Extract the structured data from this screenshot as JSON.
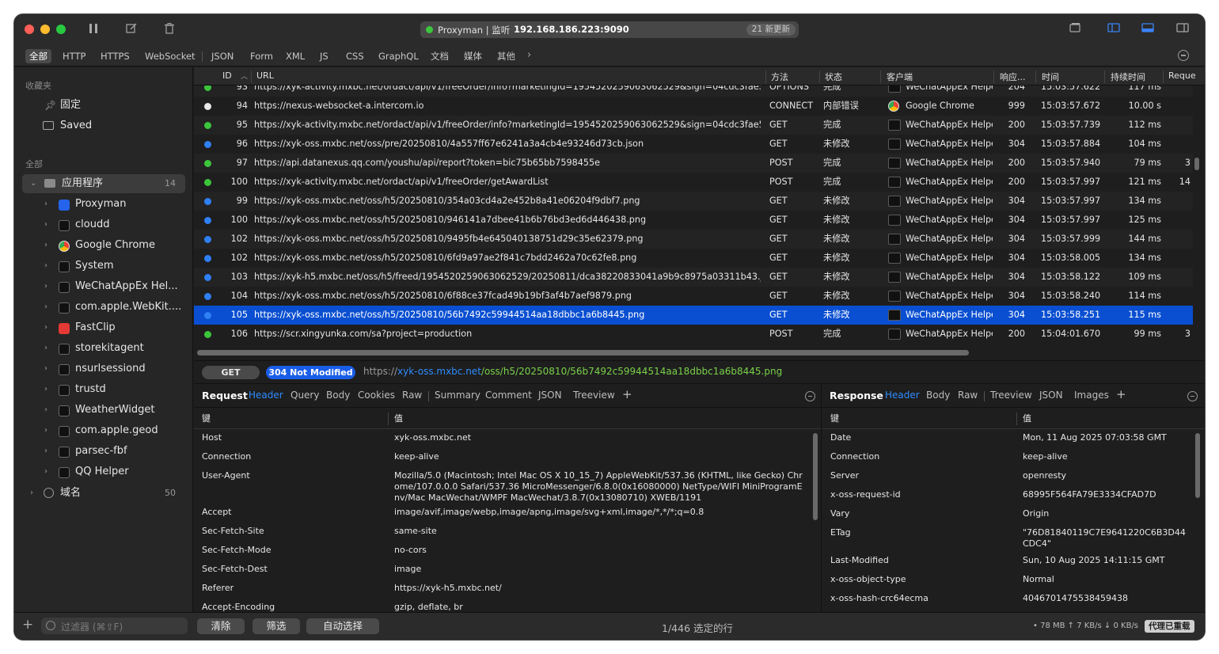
{
  "titlebar": {
    "app_name": "Proxyman | 监听",
    "address": "192.168.186.223:9090",
    "updates_badge": "21 新更新"
  },
  "filters": [
    "全部",
    "HTTP",
    "HTTPS",
    "WebSocket",
    "JSON",
    "Form",
    "XML",
    "JS",
    "CSS",
    "GraphQL",
    "文档",
    "媒体",
    "其他"
  ],
  "sidebar": {
    "favorites_header": "收藏夹",
    "pinned": "固定",
    "saved": "Saved",
    "all_header": "全部",
    "apps_group": "应用程序",
    "apps_count": "14",
    "apps": [
      {
        "label": "Proxyman",
        "icon": "proxyman-app-icon"
      },
      {
        "label": "cloudd",
        "icon": "terminal-app-icon"
      },
      {
        "label": "Google Chrome",
        "icon": "chrome-app-icon"
      },
      {
        "label": "System",
        "icon": "terminal-app-icon"
      },
      {
        "label": "WeChatAppEx Hel...",
        "icon": "terminal-app-icon"
      },
      {
        "label": "com.apple.WebKit....",
        "icon": "terminal-app-icon"
      },
      {
        "label": "FastClip",
        "icon": "fastclip-app-icon"
      },
      {
        "label": "storekitagent",
        "icon": "terminal-app-icon"
      },
      {
        "label": "nsurlsessiond",
        "icon": "terminal-app-icon"
      },
      {
        "label": "trustd",
        "icon": "terminal-app-icon"
      },
      {
        "label": "WeatherWidget",
        "icon": "terminal-app-icon"
      },
      {
        "label": "com.apple.geod",
        "icon": "terminal-app-icon"
      },
      {
        "label": "parsec-fbf",
        "icon": "terminal-app-icon"
      },
      {
        "label": "QQ Helper",
        "icon": "terminal-app-icon"
      }
    ],
    "domains_group": "域名",
    "domains_count": "50"
  },
  "table": {
    "columns": [
      "ID",
      "URL",
      "方法",
      "状态",
      "客户端",
      "响应...",
      "时间",
      "持续时间",
      "Reque"
    ],
    "rows": [
      {
        "id": "93",
        "url": "https://xyk-activity.mxbc.net/ordact/api/v1/freeOrder/info?marketingId=1954520259063062529&sign=04cdc3fae5462f...",
        "method": "OPTIONS",
        "status": "完成",
        "client": "WeChatAppEx Helper",
        "code": "204",
        "time": "15:03:57.622",
        "duration": "117 ms",
        "req": "",
        "dot": "green"
      },
      {
        "id": "94",
        "url": "https://nexus-websocket-a.intercom.io",
        "method": "CONNECT",
        "status": "内部错误",
        "client": "Google Chrome",
        "code": "999",
        "time": "15:03:57.672",
        "duration": "10.00 s",
        "req": "",
        "dot": "white"
      },
      {
        "id": "95",
        "url": "https://xyk-activity.mxbc.net/ordact/api/v1/freeOrder/info?marketingId=1954520259063062529&sign=04cdc3fae5462f...",
        "method": "GET",
        "status": "完成",
        "client": "WeChatAppEx Helper",
        "code": "200",
        "time": "15:03:57.739",
        "duration": "112 ms",
        "req": "",
        "dot": "green"
      },
      {
        "id": "96",
        "url": "https://xyk-oss.mxbc.net/oss/pre/20250810/4a557ff67e6241a3a4cb4e93246d73cb.json",
        "method": "GET",
        "status": "未修改",
        "client": "WeChatAppEx Helper",
        "code": "304",
        "time": "15:03:57.884",
        "duration": "104 ms",
        "req": "",
        "dot": "blue"
      },
      {
        "id": "97",
        "url": "https://api.datanexus.qq.com/youshu/api/report?token=bic75b65bb7598455e",
        "method": "POST",
        "status": "完成",
        "client": "WeChatAppEx Helper",
        "code": "200",
        "time": "15:03:57.940",
        "duration": "79 ms",
        "req": "3",
        "dot": "green"
      },
      {
        "id": "100",
        "url": "https://xyk-activity.mxbc.net/ordact/api/v1/freeOrder/getAwardList",
        "method": "POST",
        "status": "完成",
        "client": "WeChatAppEx Helper",
        "code": "200",
        "time": "15:03:57.997",
        "duration": "121 ms",
        "req": "14",
        "dot": "green"
      },
      {
        "id": "99",
        "url": "https://xyk-oss.mxbc.net/oss/h5/20250810/354a03cd4a2e452b8a41e06204f9dbf7.png",
        "method": "GET",
        "status": "未修改",
        "client": "WeChatAppEx Helper",
        "code": "304",
        "time": "15:03:57.997",
        "duration": "134 ms",
        "req": "",
        "dot": "blue"
      },
      {
        "id": "100",
        "url": "https://xyk-oss.mxbc.net/oss/h5/20250810/946141a7dbee41b6b76bd3ed6d446438.png",
        "method": "GET",
        "status": "未修改",
        "client": "WeChatAppEx Helper",
        "code": "304",
        "time": "15:03:57.997",
        "duration": "125 ms",
        "req": "",
        "dot": "blue"
      },
      {
        "id": "102",
        "url": "https://xyk-oss.mxbc.net/oss/h5/20250810/9495fb4e645040138751d29c35e62379.png",
        "method": "GET",
        "status": "未修改",
        "client": "WeChatAppEx Helper",
        "code": "304",
        "time": "15:03:57.999",
        "duration": "144 ms",
        "req": "",
        "dot": "blue"
      },
      {
        "id": "102",
        "url": "https://xyk-oss.mxbc.net/oss/h5/20250810/6fd9a97ae2f841c7bdd2462a70c62fe8.png",
        "method": "GET",
        "status": "未修改",
        "client": "WeChatAppEx Helper",
        "code": "304",
        "time": "15:03:58.005",
        "duration": "134 ms",
        "req": "",
        "dot": "blue"
      },
      {
        "id": "103",
        "url": "https://xyk-h5.mxbc.net/oss/h5/freed/1954520259063062529/20250811/dca38220833041a9b9c8975a03311b43.json",
        "method": "GET",
        "status": "未修改",
        "client": "WeChatAppEx Helper",
        "code": "304",
        "time": "15:03:58.122",
        "duration": "109 ms",
        "req": "",
        "dot": "blue"
      },
      {
        "id": "104",
        "url": "https://xyk-oss.mxbc.net/oss/h5/20250810/6f88ce37fcad49b19bf3af4b7aef9879.png",
        "method": "GET",
        "status": "未修改",
        "client": "WeChatAppEx Helper",
        "code": "304",
        "time": "15:03:58.240",
        "duration": "114 ms",
        "req": "",
        "dot": "blue"
      },
      {
        "id": "105",
        "url": "https://xyk-oss.mxbc.net/oss/h5/20250810/56b7492c59944514aa18dbbc1a6b8445.png",
        "method": "GET",
        "status": "未修改",
        "client": "WeChatAppEx Helper",
        "code": "304",
        "time": "15:03:58.251",
        "duration": "115 ms",
        "req": "",
        "dot": "blue",
        "selected": true
      },
      {
        "id": "106",
        "url": "https://scr.xingyunka.com/sa?project=production",
        "method": "POST",
        "status": "完成",
        "client": "WeChatAppEx Helper",
        "code": "200",
        "time": "15:04:01.670",
        "duration": "99 ms",
        "req": "3",
        "dot": "green"
      }
    ]
  },
  "request_line": {
    "method": "GET",
    "status": "304 Not Modified",
    "url_scheme": "https://",
    "url_host": "xyk-oss.mxbc.net",
    "url_path": "/oss/h5/20250810/56b7492c59944514aa18dbbc1a6b8445.png"
  },
  "request_pane": {
    "title": "Request",
    "tabs": [
      "Header",
      "Query",
      "Body",
      "Cookies",
      "Raw",
      "Summary",
      "Comment",
      "JSON",
      "Treeview"
    ],
    "key_header": "键",
    "value_header": "值",
    "rows": [
      {
        "k": "Host",
        "v": "xyk-oss.mxbc.net"
      },
      {
        "k": "Connection",
        "v": "keep-alive"
      },
      {
        "k": "User-Agent",
        "v": "Mozilla/5.0 (Macintosh; Intel Mac OS X 10_15_7) AppleWebKit/537.36 (KHTML, like Gecko) Chrome/107.0.0.0 Safari/537.36 MicroMessenger/6.8.0(0x16080000) NetType/WIFI MiniProgramEnv/Mac MacWechat/WMPF MacWechat/3.8.7(0x13080710) XWEB/1191"
      },
      {
        "k": "Accept",
        "v": "image/avif,image/webp,image/apng,image/svg+xml,image/*,*/*;q=0.8"
      },
      {
        "k": "Sec-Fetch-Site",
        "v": "same-site"
      },
      {
        "k": "Sec-Fetch-Mode",
        "v": "no-cors"
      },
      {
        "k": "Sec-Fetch-Dest",
        "v": "image"
      },
      {
        "k": "Referer",
        "v": "https://xyk-h5.mxbc.net/"
      },
      {
        "k": "Accept-Encoding",
        "v": "gzip, deflate, br"
      }
    ]
  },
  "response_pane": {
    "title": "Response",
    "tabs": [
      "Header",
      "Body",
      "Raw",
      "Treeview",
      "JSON",
      "Images"
    ],
    "key_header": "键",
    "value_header": "值",
    "rows": [
      {
        "k": "Date",
        "v": "Mon, 11 Aug 2025 07:03:58 GMT"
      },
      {
        "k": "Connection",
        "v": "keep-alive"
      },
      {
        "k": "Server",
        "v": "openresty"
      },
      {
        "k": "x-oss-request-id",
        "v": "68995F564FA79E3334CFAD7D"
      },
      {
        "k": "Vary",
        "v": "Origin"
      },
      {
        "k": "ETag",
        "v": "\"76D81840119C7E9641220C6B3D44CDC4\""
      },
      {
        "k": "Last-Modified",
        "v": "Sun, 10 Aug 2025 14:11:15 GMT"
      },
      {
        "k": "x-oss-object-type",
        "v": "Normal"
      },
      {
        "k": "x-oss-hash-crc64ecma",
        "v": "4046701475538459438"
      }
    ]
  },
  "bottom": {
    "filter_placeholder": "过滤器 (⌘⇧F)",
    "clear": "清除",
    "filter": "筛选",
    "auto_select": "自动选择",
    "selection_info": "1/446 选定的行",
    "network_stats": "• 78 MB ↑ 7 KB/s ↓ 0 KB/s",
    "proxy_badge": "代理已重载"
  },
  "colors": {
    "selected_row": "#0a4fd1",
    "dot_green": "#3cc53c",
    "dot_blue": "#2f7ff5",
    "badge_blue": "#1a5ee8",
    "link_blue": "#2e8cff"
  }
}
